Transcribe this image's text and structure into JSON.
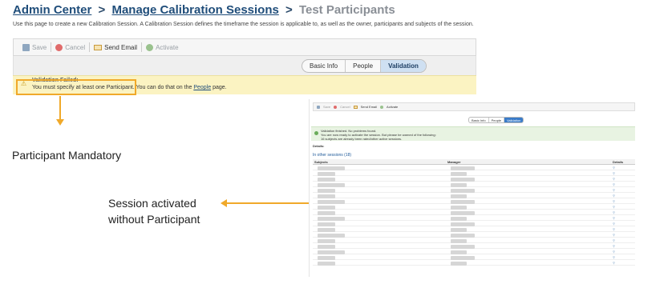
{
  "breadcrumb": {
    "admin_center": "Admin Center",
    "separator_1": ">",
    "manage_sessions": "Manage Calibration Sessions",
    "separator_2": ">",
    "current": "Test Participants"
  },
  "description": "Use this page to create a new Calibration Session. A Calibration Session defines the timeframe the session is applicable to, as well as the owner, participants and subjects of the session.",
  "toolbar": {
    "save_label": "Save",
    "cancel_label": "Cancel",
    "send_email_label": "Send Email",
    "activate_label": "Activate"
  },
  "tabs": [
    {
      "label": "Basic Info",
      "selected": false
    },
    {
      "label": "People",
      "selected": false
    },
    {
      "label": "Validation",
      "selected": true
    }
  ],
  "validation": {
    "title": "Validation Failed:",
    "message_before_link": "You must specify at least one Participant. You can do that on the ",
    "link_text": "People",
    "message_after_link": " page."
  },
  "annotations": {
    "participant_mandatory": "Participant Mandatory",
    "session_activated_line1": "Session activated",
    "session_activated_line2": "without Participant"
  },
  "inset": {
    "toolbar": {
      "save_label": "Save",
      "cancel_label": "Cancel",
      "send_email_label": "Send Email",
      "activate_label": "Activate"
    },
    "tabs": [
      {
        "label": "Basic Info",
        "selected": false
      },
      {
        "label": "People",
        "selected": false
      },
      {
        "label": "Validation",
        "selected": true
      }
    ],
    "success": {
      "line1": "Validation finished. No problems found.",
      "line2": "You are now ready to activate the session. But please be warned of the following:",
      "line3": "16 subjects are already been rated/other active sessions."
    },
    "details_label": "Details:",
    "other_sessions_label": "In other sessions (18)",
    "columns": [
      "Subjects",
      "Manager",
      "Details"
    ]
  },
  "colors": {
    "accent_orange": "#f0a92a",
    "warning_bg": "#fbf3c2",
    "success_bg": "#e8f3e2",
    "tab_selected_bg": "#cfe0f2",
    "breadcrumb_link": "#1f4d7a"
  }
}
